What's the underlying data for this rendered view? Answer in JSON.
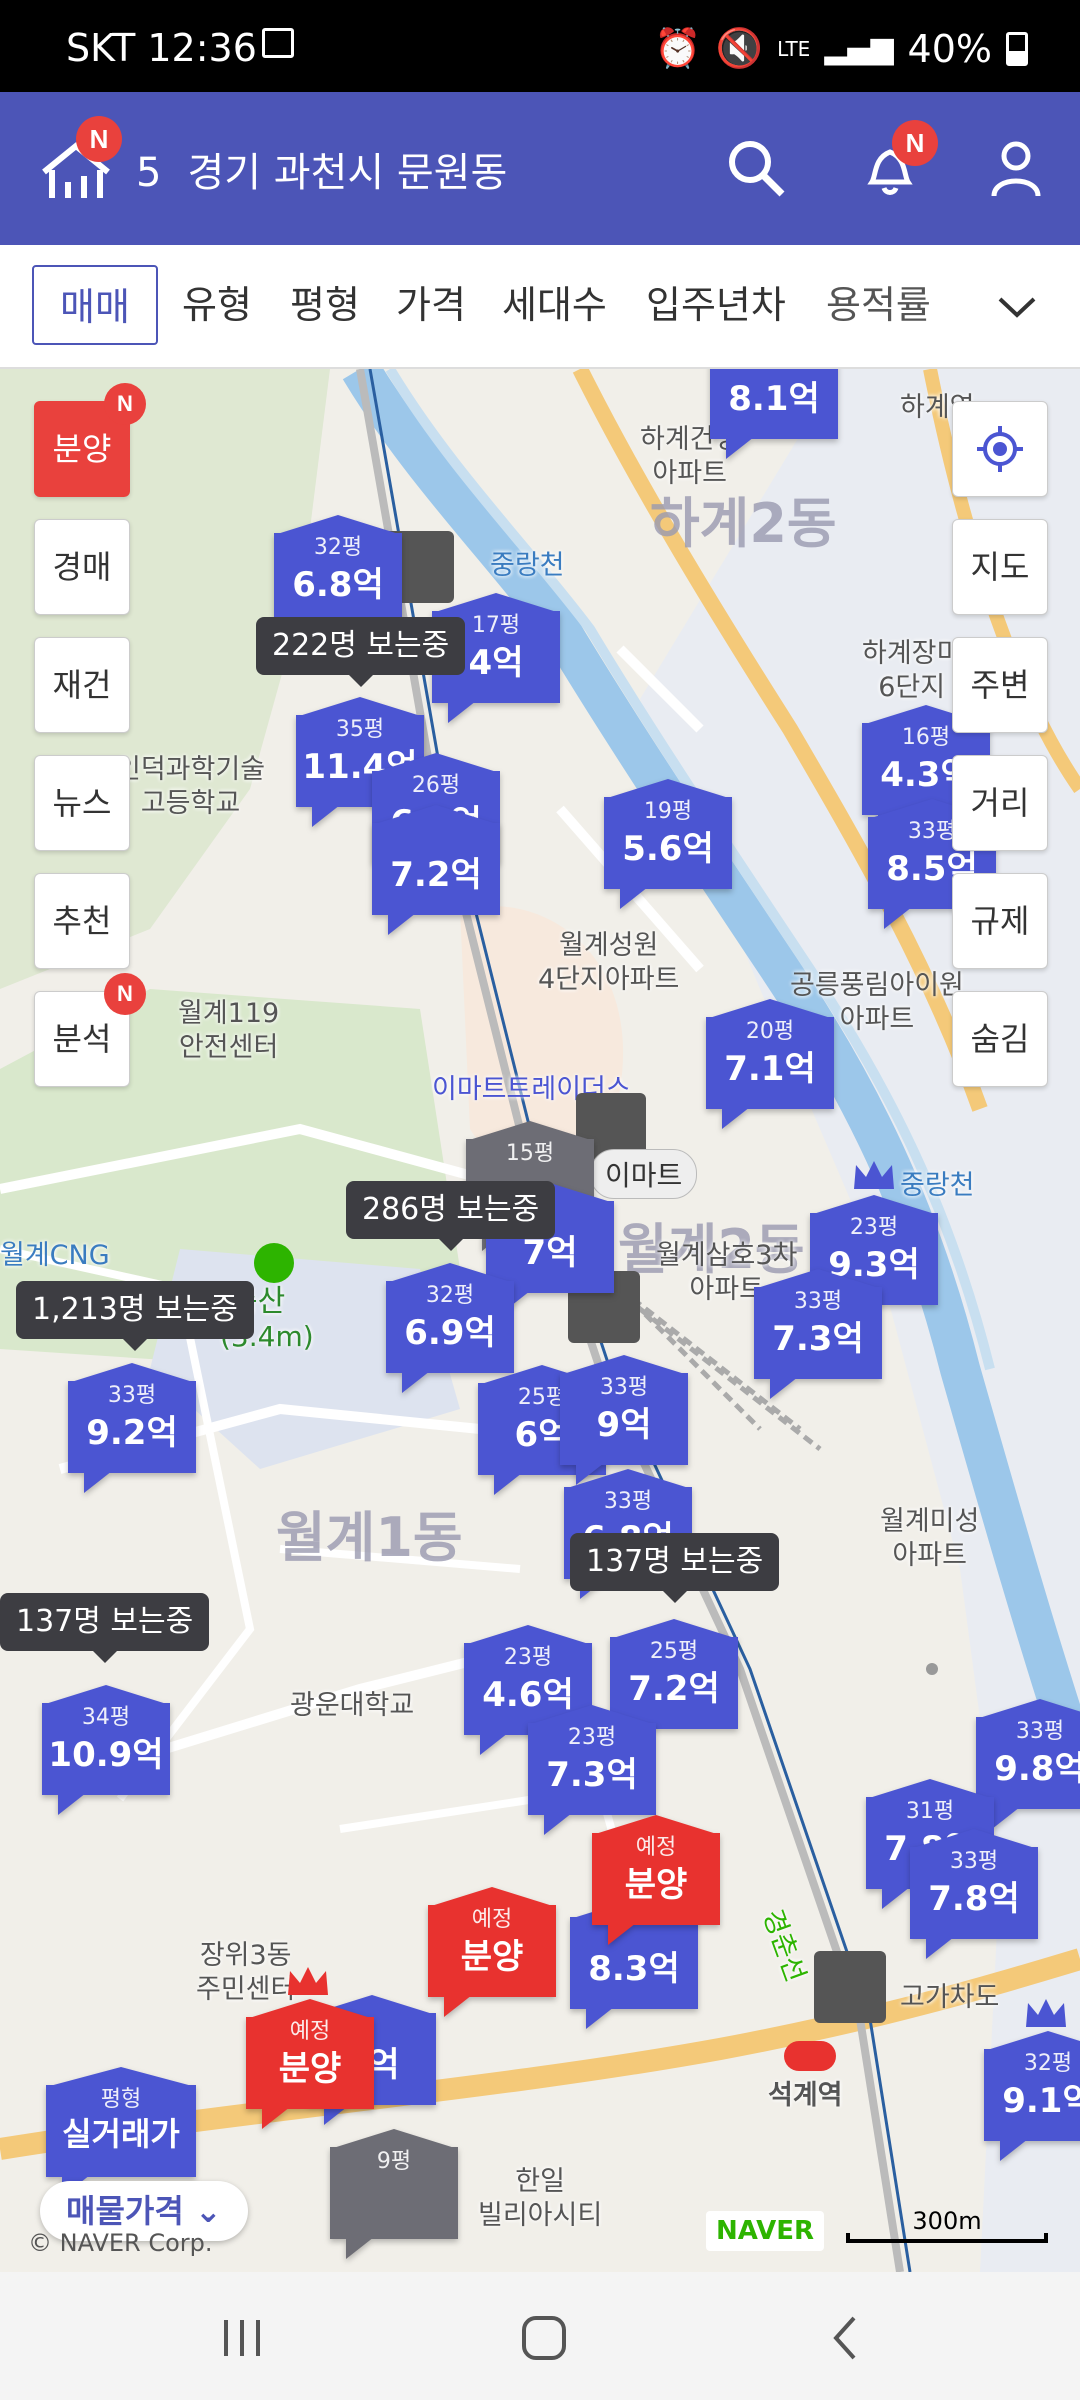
{
  "status": {
    "carrier_time": "SKT 12:36",
    "battery": "40%",
    "network": "LTE"
  },
  "header": {
    "badge": "N",
    "count": "5",
    "location": "경기 과천시 문원동",
    "notif_badge": "N"
  },
  "filters": {
    "active": "매매",
    "items": [
      "유형",
      "평형",
      "가격",
      "세대수",
      "입주년차",
      "용적률"
    ]
  },
  "left_buttons": [
    {
      "label": "분양",
      "badge": "N"
    },
    {
      "label": "경매"
    },
    {
      "label": "재건"
    },
    {
      "label": "뉴스"
    },
    {
      "label": "추천"
    },
    {
      "label": "분석",
      "badge": "N"
    }
  ],
  "right_buttons": [
    "지도",
    "주변",
    "거리",
    "규제",
    "숨김"
  ],
  "areas": [
    "하계2동",
    "월계2동",
    "월계1동"
  ],
  "labels": {
    "l1": "하계건영\n아파트",
    "l2": "중랑천",
    "l3": "인덕과학기술\n고등학교",
    "l4": "월계성원\n4단지아파트",
    "l5": "월계119\n안전센터",
    "l6": "이마트트레이더스",
    "l7": "월계CNG",
    "l8": "월계삼호3차\n아파트",
    "l9": "광운대학교",
    "l10": "장위3동\n주민센터",
    "l11": "석계역",
    "l12": "하계장미\n6단지",
    "l13": "공릉풍림아이원\n아파트",
    "l14": "월계미성\n아파트",
    "l15": "한일\n빌리아시티",
    "l16": "고가차도",
    "l17": "이마트",
    "l18": "중랑천",
    "l19": "경춘선",
    "l20": "하계역"
  },
  "markers": [
    {
      "size": "32평",
      "price": "6.8억"
    },
    {
      "size": "17평",
      "price": "4억"
    },
    {
      "size": "35평",
      "price": "11.4억"
    },
    {
      "size": "26평",
      "price": "6.1억"
    },
    {
      "size": "",
      "price": "7.2억"
    },
    {
      "size": "19평",
      "price": "5.6억"
    },
    {
      "size": "",
      "price": "8.1억"
    },
    {
      "size": "16평",
      "price": "4.3억"
    },
    {
      "size": "33평",
      "price": "8.5억"
    },
    {
      "size": "20평",
      "price": "7.1억"
    },
    {
      "size": "15평",
      "price": ""
    },
    {
      "size": "",
      "price": "7억"
    },
    {
      "size": "32평",
      "price": "6.9억"
    },
    {
      "size": "23평",
      "price": "9.3억"
    },
    {
      "size": "33평",
      "price": "7.3억"
    },
    {
      "size": "33평",
      "price": "9.2억"
    },
    {
      "size": "25평",
      "price": "6억"
    },
    {
      "size": "33평",
      "price": "9억"
    },
    {
      "size": "33평",
      "price": "6.8억"
    },
    {
      "size": "23평",
      "price": "4.6억"
    },
    {
      "size": "25평",
      "price": "7.2억"
    },
    {
      "size": "34평",
      "price": "10.9억"
    },
    {
      "size": "23평",
      "price": "7.3억"
    },
    {
      "size": "33평",
      "price": "9.8억"
    },
    {
      "size": "31평",
      "price": "7.8억"
    },
    {
      "size": "33평",
      "price": "7.8억"
    },
    {
      "size": "",
      "price": "8.3억"
    },
    {
      "size": "32평",
      "price": "9.1억"
    },
    {
      "size": "평형",
      "price": "실거래가"
    },
    {
      "size": "9평",
      "price": ""
    },
    {
      "size": "",
      "price": "4억"
    }
  ],
  "presale": [
    {
      "tag": "예정",
      "label": "분양"
    },
    {
      "tag": "예정",
      "label": "분양"
    },
    {
      "tag": "예정",
      "label": "분양"
    }
  ],
  "tips": [
    "222명 보는중",
    "286명 보는중",
    "1,213명 보는중",
    "137명 보는중",
    "137명 보는중"
  ],
  "park": {
    "name": "축산",
    "height": "(3.4m)"
  },
  "bottom": {
    "price_toggle": "매물가격",
    "copyright": "© NAVER Corp.",
    "naver": "NAVER",
    "scale": "300m"
  },
  "colors": {
    "header": "#4c55b7",
    "marker": "#4b55d2",
    "presale": "#e8322f"
  }
}
